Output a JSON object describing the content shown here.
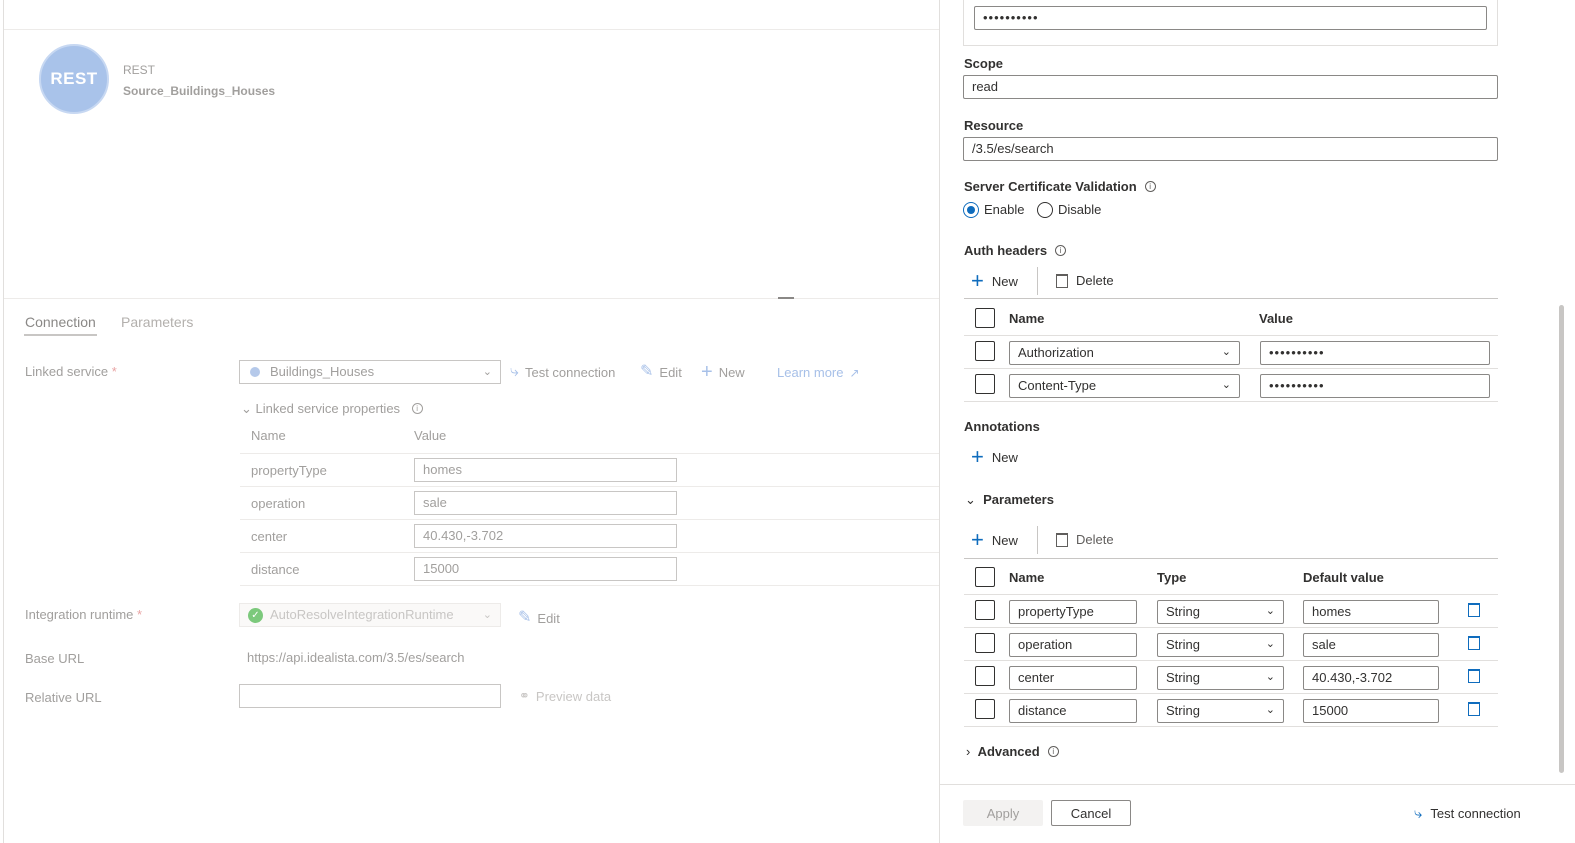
{
  "dataset": {
    "type_label": "REST",
    "name": "Source_Buildings_Houses",
    "logo_text": "REST"
  },
  "tabs": [
    {
      "label": "Connection"
    },
    {
      "label": "Parameters"
    }
  ],
  "connection": {
    "linked_service_label": "Linked service",
    "linked_service_value": "Buildings_Houses",
    "test_connection": "Test connection",
    "edit": "Edit",
    "new": "New",
    "learn_more": "Learn more",
    "props_toggle": "Linked service properties",
    "props_header_name": "Name",
    "props_header_value": "Value",
    "props": [
      {
        "name": "propertyType",
        "value": "homes"
      },
      {
        "name": "operation",
        "value": "sale"
      },
      {
        "name": "center",
        "value": "40.430,-3.702"
      },
      {
        "name": "distance",
        "value": "15000"
      }
    ],
    "runtime_label": "Integration runtime",
    "runtime_value": "AutoResolveIntegrationRuntime",
    "runtime_edit": "Edit",
    "base_url_label": "Base URL",
    "base_url_value": "https://api.idealista.com/3.5/es/search",
    "relative_url_label": "Relative URL",
    "relative_url_value": "",
    "preview_data": "Preview data"
  },
  "panel": {
    "secret_masked": "••••••••••",
    "scope_label": "Scope",
    "scope_value": "read",
    "resource_label": "Resource",
    "resource_value": "/3.5/es/search",
    "cert_label": "Server Certificate Validation",
    "cert_enable": "Enable",
    "cert_disable": "Disable",
    "cert_selected": "Enable",
    "auth_headers_label": "Auth headers",
    "new_label": "New",
    "delete_label": "Delete",
    "auth_col_name": "Name",
    "auth_col_value": "Value",
    "auth_headers": [
      {
        "name": "Authorization",
        "value": "••••••••••"
      },
      {
        "name": "Content-Type",
        "value": "••••••••••"
      }
    ],
    "annotations_label": "Annotations",
    "annotations_new": "New",
    "parameters_label": "Parameters",
    "param_col_name": "Name",
    "param_col_type": "Type",
    "param_col_default": "Default value",
    "parameters": [
      {
        "name": "propertyType",
        "type": "String",
        "default": "homes"
      },
      {
        "name": "operation",
        "type": "String",
        "default": "sale"
      },
      {
        "name": "center",
        "type": "String",
        "default": "40.430,-3.702"
      },
      {
        "name": "distance",
        "type": "String",
        "default": "15000"
      }
    ],
    "advanced_label": "Advanced",
    "apply": "Apply",
    "cancel": "Cancel",
    "test_connection": "Test connection"
  },
  "colors": {
    "accent": "#0f6cbd",
    "required": "#e8a3a3",
    "runtime_ok": "#7cc97c"
  }
}
